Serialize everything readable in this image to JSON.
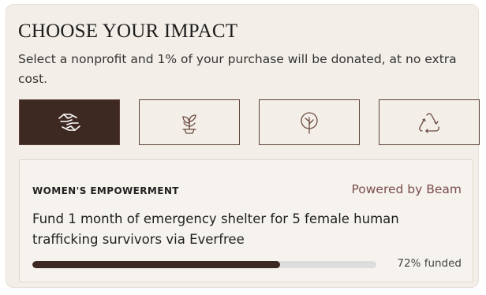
{
  "header": {
    "title": "CHOOSE YOUR IMPACT",
    "subtitle": "Select a nonprofit and 1% of your purchase will be donated, at no extra cost."
  },
  "causes": [
    {
      "icon": "helping-hands-icon",
      "selected": true
    },
    {
      "icon": "seedling-icon",
      "selected": false
    },
    {
      "icon": "tree-icon",
      "selected": false
    },
    {
      "icon": "recycle-icon",
      "selected": false
    }
  ],
  "impact": {
    "category": "WOMEN'S EMPOWERMENT",
    "powered_by": "Powered by Beam",
    "description": "Fund 1 month of emergency shelter for 5 female human trafficking survivors via Everfree",
    "progress_percent": 72,
    "funded_text": "72% funded"
  },
  "colors": {
    "accent": "#3e2822",
    "card_bg": "#f3efe8",
    "powered_text": "#7a4b4b",
    "icon_stroke": "#6b4a40"
  }
}
